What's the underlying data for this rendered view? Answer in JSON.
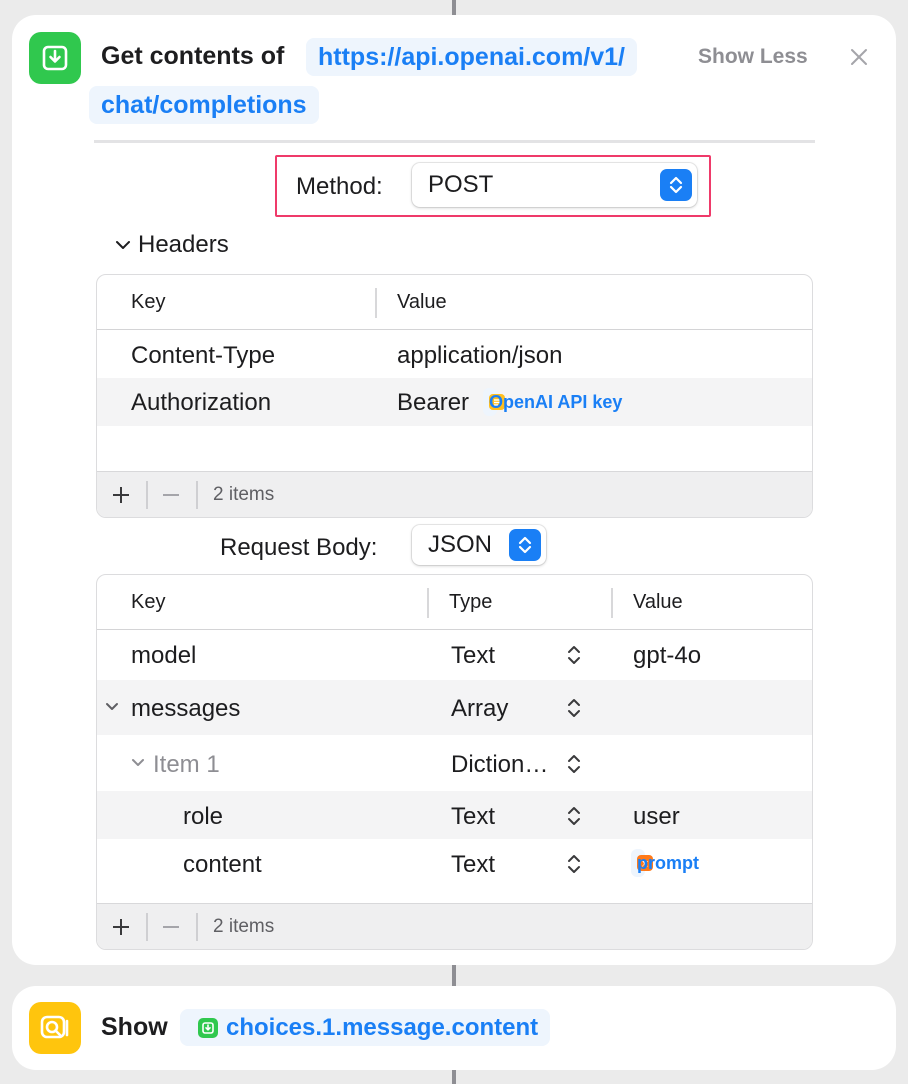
{
  "get_action": {
    "title": "Get contents of",
    "url_line1": "https://api.openai.com/v1/",
    "url_line2": "chat/completions",
    "show_less_label": "Show Less",
    "method": {
      "label": "Method:",
      "value": "POST"
    },
    "headers": {
      "label": "Headers",
      "columns": {
        "key": "Key",
        "value": "Value"
      },
      "rows": [
        {
          "key": "Content-Type",
          "value": "application/json"
        },
        {
          "key": "Authorization",
          "value_prefix": "Bearer",
          "variable": "OpenAI API key"
        }
      ],
      "count_label": "2 items"
    },
    "request_body": {
      "label": "Request Body:",
      "value": "JSON",
      "columns": {
        "key": "Key",
        "type": "Type",
        "value": "Value"
      },
      "rows": [
        {
          "key": "model",
          "type": "Text",
          "value": "gpt-4o"
        },
        {
          "key": "messages",
          "type": "Array",
          "value": ""
        },
        {
          "key": "Item 1",
          "type": "Diction…",
          "value": ""
        },
        {
          "key": "role",
          "type": "Text",
          "value": "user"
        },
        {
          "key": "content",
          "type": "Text",
          "variable": "prompt"
        }
      ],
      "count_label": "2 items"
    }
  },
  "show_action": {
    "title": "Show",
    "variable": "choices.1.message.content"
  },
  "colors": {
    "accent": "#1a7ff5",
    "get_icon": "#30c84e",
    "show_icon": "#ffc50d",
    "highlight_border": "#ef3a6a",
    "text_variable_icon": "#ffbf1f",
    "ask_variable_icon": "#ff7a1a"
  },
  "icons": {
    "get_action": "download-tray-icon",
    "show_action": "quicklook-icon",
    "close": "close-icon",
    "popup": "up-down-chevron-icon",
    "disclosure": "chevron-down-icon",
    "text_variable": "text-variable-icon",
    "ask_variable": "ask-variable-icon"
  }
}
